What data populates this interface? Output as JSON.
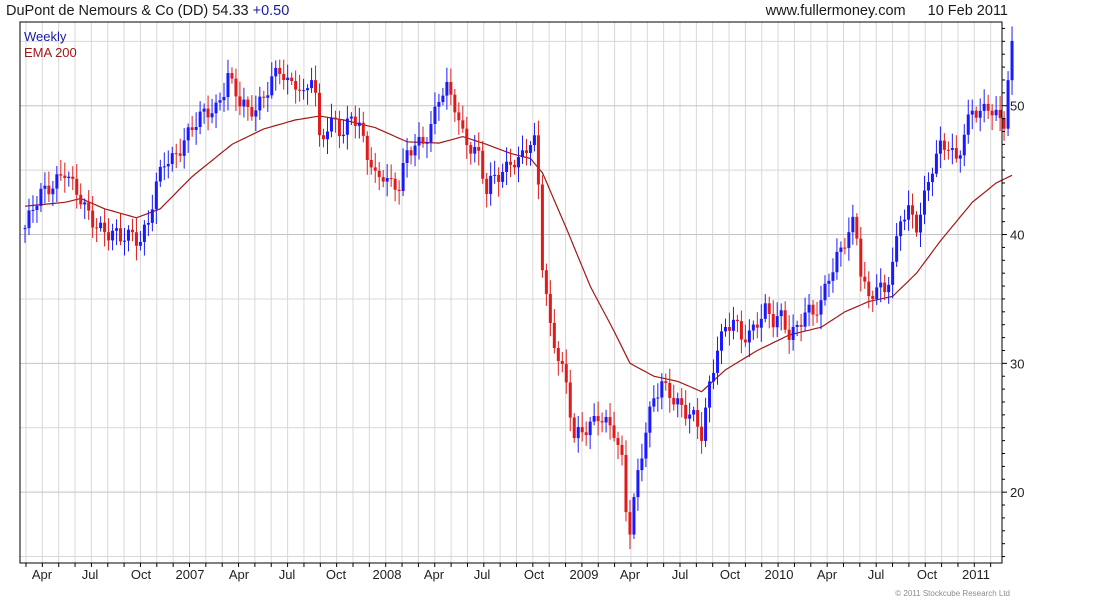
{
  "header": {
    "title": "DuPont de Nemours & Co (DD) 54.33",
    "change": "+0.50",
    "website": "www.fullermoney.com",
    "date": "10 Feb 2011"
  },
  "legend": {
    "series1": "Weekly",
    "series2": "EMA 200"
  },
  "colors": {
    "up": "#1a1aff",
    "down": "#e01b1b",
    "ema": "#a01818",
    "grid": "#d8d8d8",
    "axis": "#000000"
  },
  "copyright": "© 2011 Stockcube Research Ltd",
  "chart_data": {
    "type": "candlestick",
    "title": "DuPont de Nemours & Co (DD) 54.33 +0.50",
    "y_axis": {
      "side": "right",
      "min": 14.5,
      "max": 56.5,
      "ticks": [
        20,
        30,
        40,
        50
      ]
    },
    "x_ticks": [
      "Apr",
      "Jul",
      "Oct",
      "2007",
      "Apr",
      "Jul",
      "Oct",
      "2008",
      "Apr",
      "Jul",
      "Oct",
      "2009",
      "Apr",
      "Jul",
      "Oct",
      "2010",
      "Apr",
      "Jul",
      "Oct",
      "2011"
    ],
    "grid": true,
    "series": [
      {
        "name": "Weekly",
        "kind": "close",
        "anchors": [
          [
            0,
            40.5
          ],
          [
            4,
            43.0
          ],
          [
            8,
            44.5
          ],
          [
            10,
            45.0
          ],
          [
            12,
            43.5
          ],
          [
            15,
            42.0
          ],
          [
            18,
            41.0
          ],
          [
            21,
            40.0
          ],
          [
            24,
            39.5
          ],
          [
            27,
            40.2
          ],
          [
            29,
            39.8
          ],
          [
            31,
            41.0
          ],
          [
            33,
            43.5
          ],
          [
            35,
            45.5
          ],
          [
            37,
            46.0
          ],
          [
            40,
            47.5
          ],
          [
            43,
            48.5
          ],
          [
            46,
            49.5
          ],
          [
            48,
            50.0
          ],
          [
            50,
            51.5
          ],
          [
            51,
            52.5
          ],
          [
            52,
            51.5
          ],
          [
            54,
            50.0
          ],
          [
            56,
            49.5
          ],
          [
            58,
            50.0
          ],
          [
            60,
            51.0
          ],
          [
            62,
            52.0
          ],
          [
            64,
            52.5
          ],
          [
            66,
            51.5
          ],
          [
            68,
            52.0
          ],
          [
            70,
            51.0
          ],
          [
            72,
            52.5
          ],
          [
            73,
            50.5
          ],
          [
            74,
            47.0
          ],
          [
            76,
            48.0
          ],
          [
            78,
            49.0
          ],
          [
            80,
            48.0
          ],
          [
            82,
            49.5
          ],
          [
            84,
            48.0
          ],
          [
            86,
            46.0
          ],
          [
            88,
            44.5
          ],
          [
            90,
            45.0
          ],
          [
            92,
            44.0
          ],
          [
            94,
            43.5
          ],
          [
            96,
            46.0
          ],
          [
            98,
            47.0
          ],
          [
            100,
            47.5
          ],
          [
            102,
            48.5
          ],
          [
            104,
            50.5
          ],
          [
            106,
            51.0
          ],
          [
            108,
            50.0
          ],
          [
            110,
            48.0
          ],
          [
            112,
            47.0
          ],
          [
            114,
            46.0
          ],
          [
            116,
            43.0
          ],
          [
            118,
            44.5
          ],
          [
            120,
            45.0
          ],
          [
            122,
            46.0
          ],
          [
            124,
            45.5
          ],
          [
            126,
            46.5
          ],
          [
            128,
            47.0
          ],
          [
            129,
            44.0
          ],
          [
            130,
            38.0
          ],
          [
            132,
            33.0
          ],
          [
            134,
            30.5
          ],
          [
            136,
            28.0
          ],
          [
            138,
            24.0
          ],
          [
            140,
            25.0
          ],
          [
            142,
            25.5
          ],
          [
            144,
            26.0
          ],
          [
            146,
            25.0
          ],
          [
            148,
            24.5
          ],
          [
            150,
            22.5
          ],
          [
            151,
            19.0
          ],
          [
            152,
            17.5
          ],
          [
            154,
            21.5
          ],
          [
            156,
            24.5
          ],
          [
            158,
            27.0
          ],
          [
            160,
            28.5
          ],
          [
            162,
            28.0
          ],
          [
            164,
            27.0
          ],
          [
            166,
            26.0
          ],
          [
            168,
            25.5
          ],
          [
            170,
            24.5
          ],
          [
            172,
            28.5
          ],
          [
            174,
            31.5
          ],
          [
            176,
            32.5
          ],
          [
            178,
            33.0
          ],
          [
            180,
            32.0
          ],
          [
            182,
            32.5
          ],
          [
            184,
            33.5
          ],
          [
            186,
            34.0
          ],
          [
            188,
            33.0
          ],
          [
            190,
            33.5
          ],
          [
            192,
            32.5
          ],
          [
            194,
            33.0
          ],
          [
            196,
            34.0
          ],
          [
            198,
            33.5
          ],
          [
            200,
            34.5
          ],
          [
            202,
            37.0
          ],
          [
            204,
            38.5
          ],
          [
            206,
            39.5
          ],
          [
            208,
            40.5
          ],
          [
            209,
            39.5
          ],
          [
            210,
            37.0
          ],
          [
            212,
            35.0
          ],
          [
            214,
            36.5
          ],
          [
            216,
            35.5
          ],
          [
            218,
            37.5
          ],
          [
            219,
            39.0
          ],
          [
            220,
            41.0
          ],
          [
            222,
            42.0
          ],
          [
            224,
            41.0
          ],
          [
            226,
            43.0
          ],
          [
            228,
            45.0
          ],
          [
            230,
            46.5
          ],
          [
            232,
            47.0
          ],
          [
            234,
            46.0
          ],
          [
            236,
            48.0
          ],
          [
            238,
            49.5
          ],
          [
            240,
            49.0
          ],
          [
            242,
            50.0
          ],
          [
            244,
            49.5
          ],
          [
            246,
            49.0
          ],
          [
            247,
            52.0
          ],
          [
            248,
            54.33
          ]
        ]
      },
      {
        "name": "EMA 200",
        "kind": "line",
        "points": [
          [
            0,
            42.2
          ],
          [
            10,
            42.5
          ],
          [
            14,
            42.8
          ],
          [
            20,
            42.0
          ],
          [
            28,
            41.3
          ],
          [
            34,
            42.0
          ],
          [
            42,
            44.5
          ],
          [
            52,
            47.0
          ],
          [
            60,
            48.2
          ],
          [
            68,
            48.9
          ],
          [
            74,
            49.2
          ],
          [
            80,
            48.9
          ],
          [
            88,
            48.3
          ],
          [
            96,
            47.2
          ],
          [
            104,
            47.1
          ],
          [
            110,
            47.6
          ],
          [
            116,
            47.0
          ],
          [
            122,
            46.3
          ],
          [
            127,
            45.9
          ],
          [
            130,
            44.8
          ],
          [
            136,
            40.5
          ],
          [
            142,
            36.0
          ],
          [
            148,
            32.5
          ],
          [
            152,
            30.0
          ],
          [
            158,
            29.0
          ],
          [
            164,
            28.6
          ],
          [
            170,
            27.8
          ],
          [
            176,
            29.5
          ],
          [
            184,
            31.0
          ],
          [
            192,
            32.2
          ],
          [
            200,
            32.8
          ],
          [
            206,
            34.0
          ],
          [
            212,
            34.8
          ],
          [
            218,
            35.2
          ],
          [
            224,
            37.0
          ],
          [
            230,
            39.5
          ],
          [
            238,
            42.5
          ],
          [
            244,
            44.0
          ],
          [
            248,
            44.6
          ]
        ]
      }
    ]
  }
}
